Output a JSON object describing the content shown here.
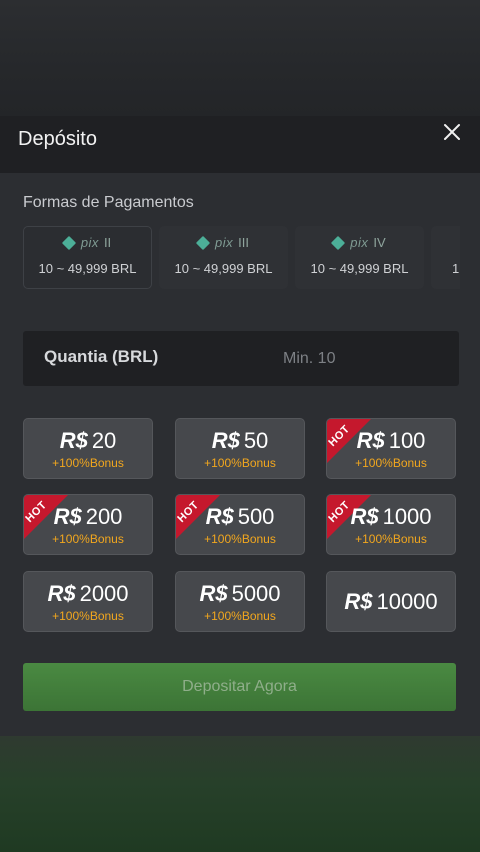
{
  "modal": {
    "title": "Depósito"
  },
  "payment": {
    "section_label": "Formas de Pagamentos",
    "methods": [
      {
        "logo": "pix",
        "variant": "II",
        "range": "10 ~ 49,999 BRL",
        "active": true
      },
      {
        "logo": "pix",
        "variant": "III",
        "range": "10 ~ 49,999 BRL",
        "active": false
      },
      {
        "logo": "pix",
        "variant": "IV",
        "range": "10 ~ 49,999 BRL",
        "active": false
      },
      {
        "logo": "",
        "variant": "",
        "range": "1",
        "active": false
      }
    ]
  },
  "amount": {
    "label": "Quantia (BRL)",
    "placeholder": "Min. 10"
  },
  "chips": [
    {
      "currency": "R$",
      "value": "20",
      "bonus": "+100%Bonus",
      "hot": false
    },
    {
      "currency": "R$",
      "value": "50",
      "bonus": "+100%Bonus",
      "hot": false
    },
    {
      "currency": "R$",
      "value": "100",
      "bonus": "+100%Bonus",
      "hot": true
    },
    {
      "currency": "R$",
      "value": "200",
      "bonus": "+100%Bonus",
      "hot": true
    },
    {
      "currency": "R$",
      "value": "500",
      "bonus": "+100%Bonus",
      "hot": true
    },
    {
      "currency": "R$",
      "value": "1000",
      "bonus": "+100%Bonus",
      "hot": true
    },
    {
      "currency": "R$",
      "value": "2000",
      "bonus": "+100%Bonus",
      "hot": false
    },
    {
      "currency": "R$",
      "value": "5000",
      "bonus": "+100%Bonus",
      "hot": false
    },
    {
      "currency": "R$",
      "value": "10000",
      "bonus": "",
      "hot": false
    }
  ],
  "hot_label": "HOT",
  "deposit_button": {
    "label": "Depositar Agora"
  },
  "colors": {
    "accent_green": "#3f7a3a",
    "bonus_orange": "#f2a71e",
    "hot_red": "#c5182d",
    "pix_teal": "#4caf98"
  }
}
